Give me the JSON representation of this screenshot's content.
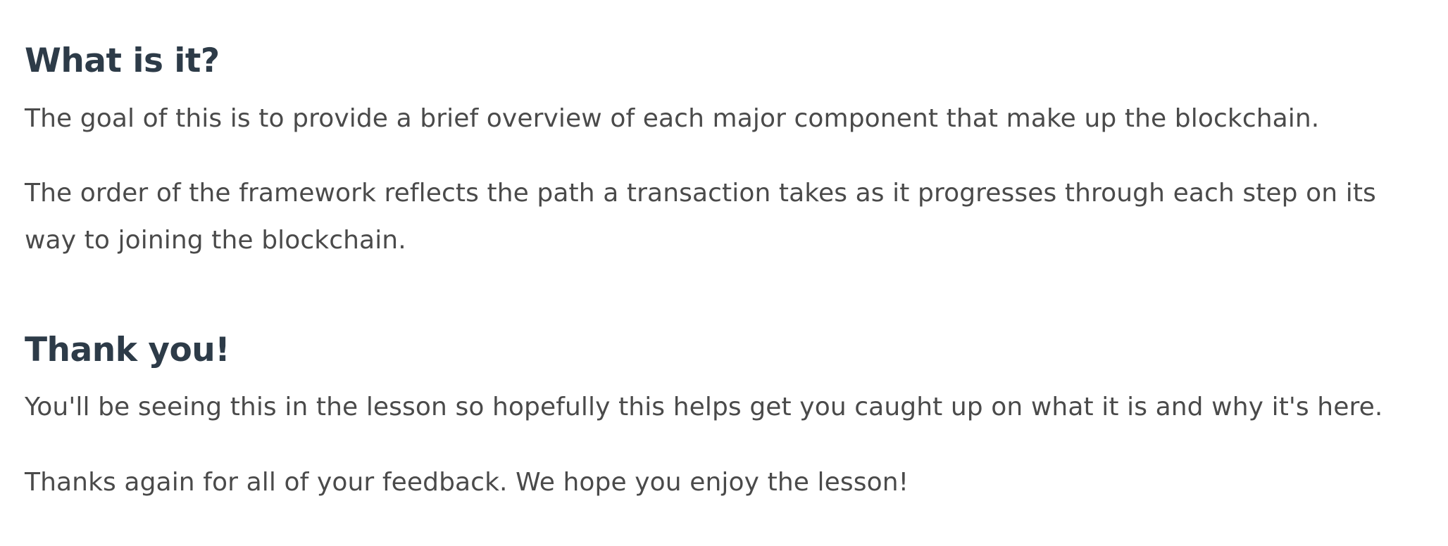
{
  "sections": [
    {
      "title": "What is it?",
      "paragraphs": [
        "The goal of this is to provide a brief overview of each major component that make up the blockchain.",
        "The order of the framework reflects the path a transaction takes as it progresses through each step on its way to joining the blockchain."
      ]
    },
    {
      "title": "Thank you!",
      "paragraphs": [
        "You'll be seeing this in the lesson so hopefully this helps get you caught up on what it is and why it's here.",
        "Thanks again for all of your feedback. We hope you enjoy the lesson!"
      ]
    }
  ],
  "colors": {
    "heading": "#2d3b48",
    "body_text": "#4a4a4a",
    "background": "#ffffff"
  }
}
